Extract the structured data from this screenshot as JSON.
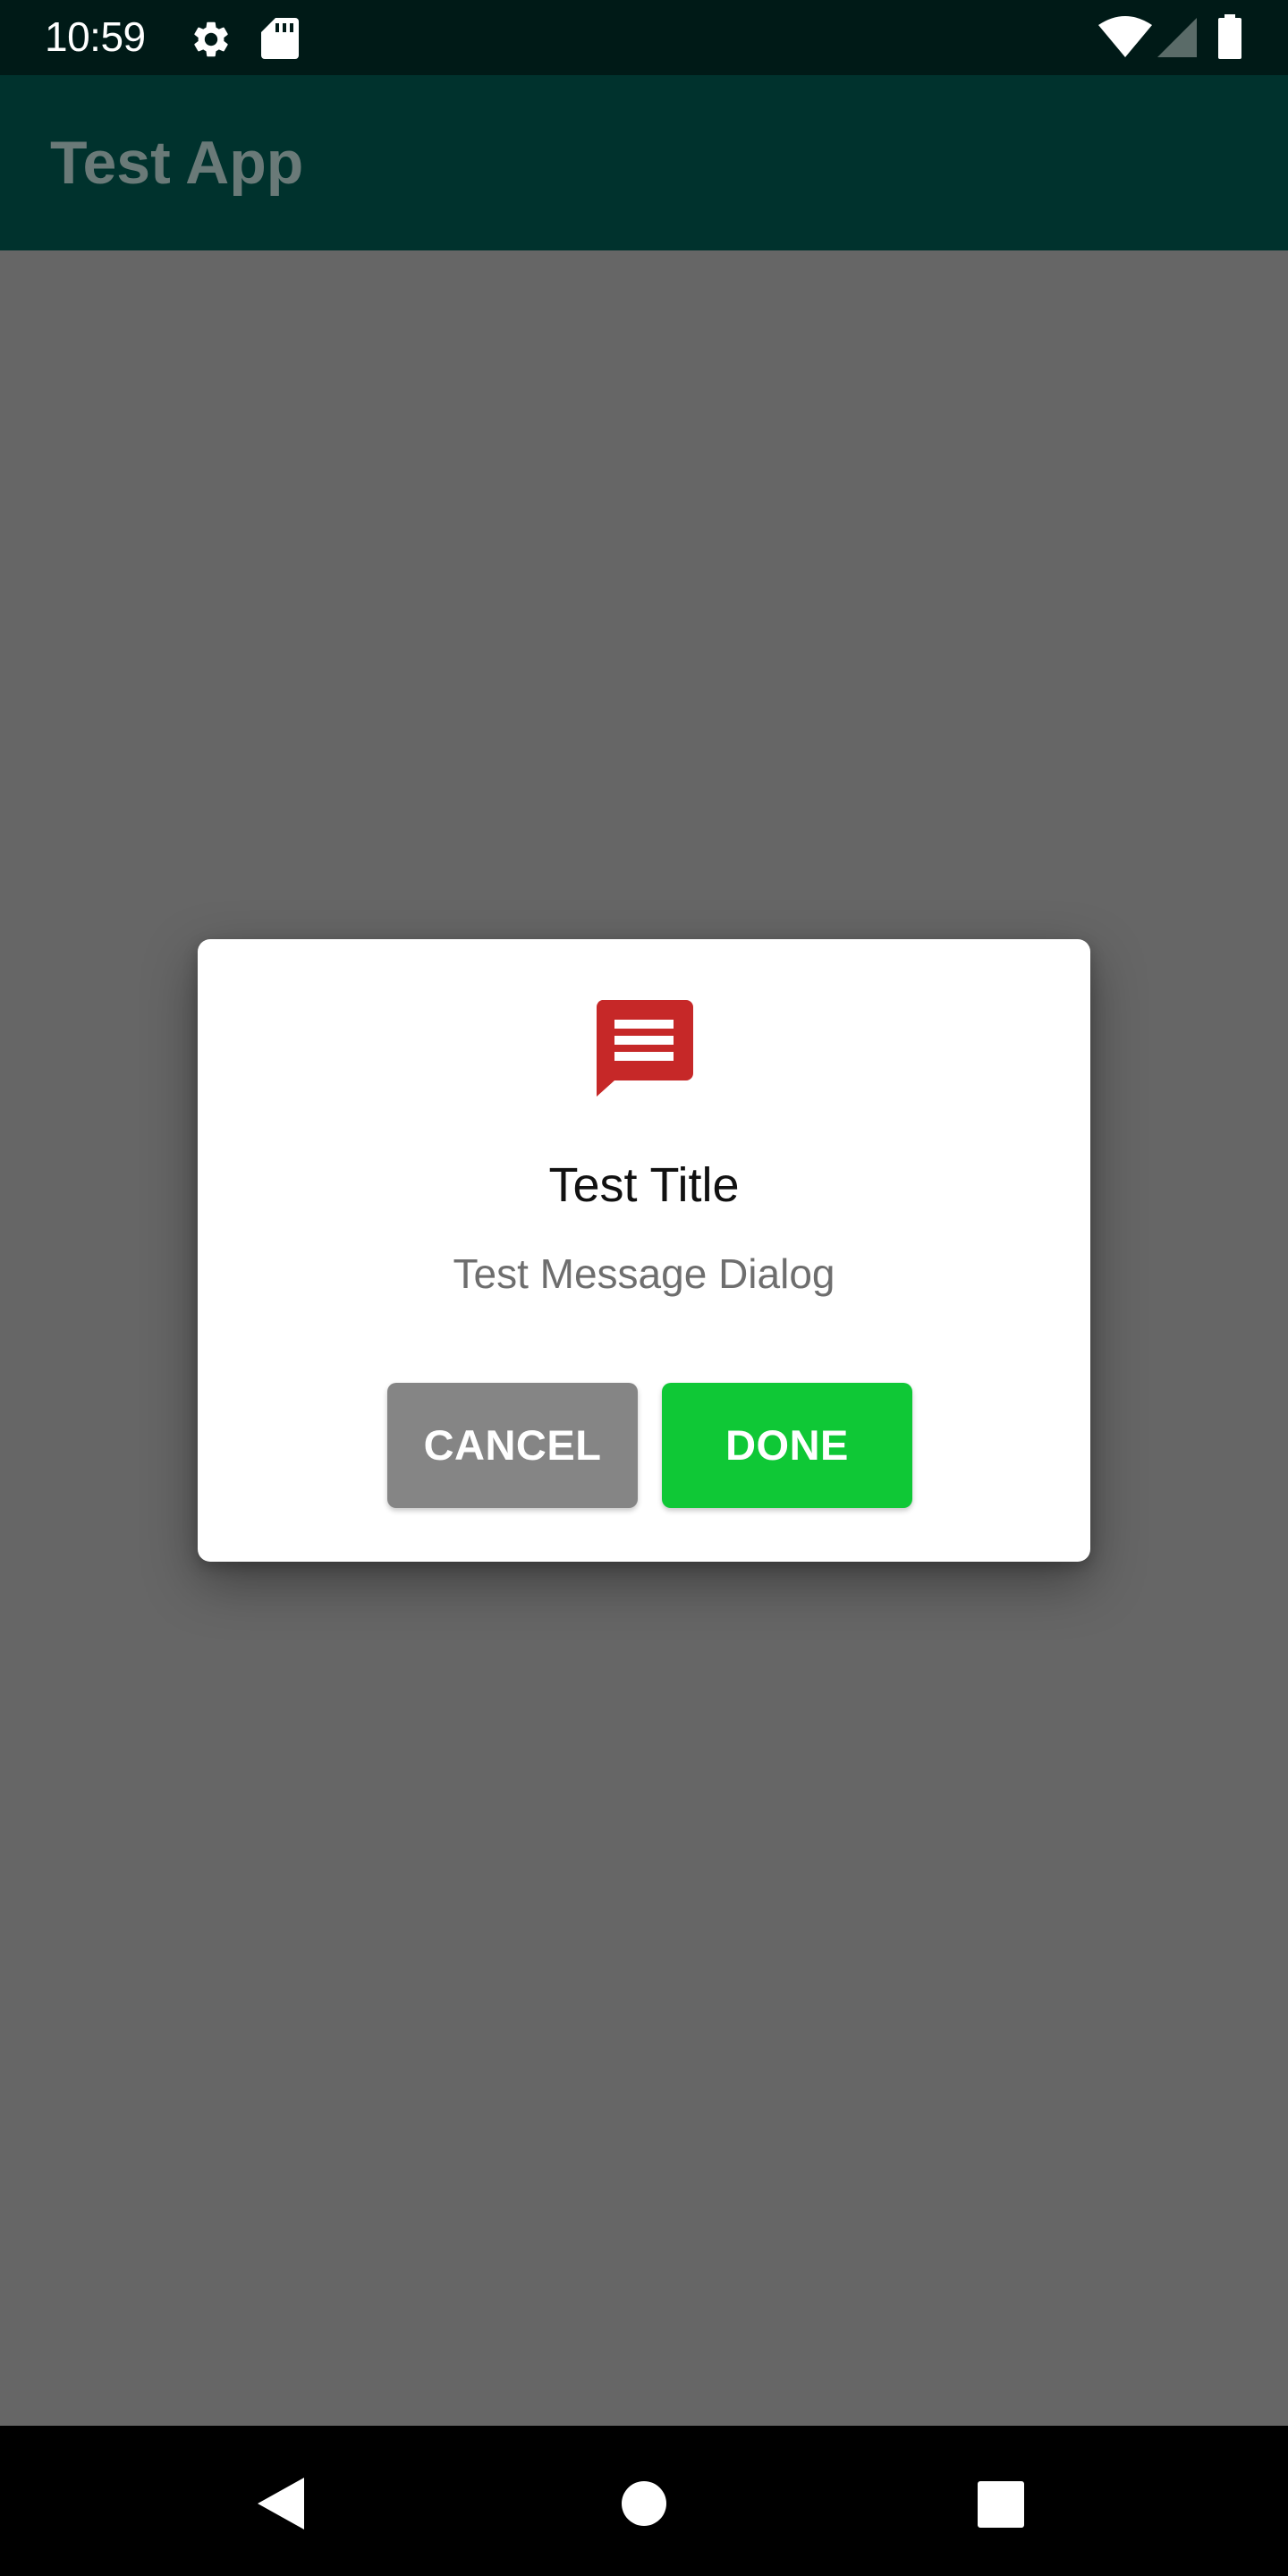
{
  "status_bar": {
    "time": "10:59",
    "left_icons": [
      "gear-icon",
      "sd-card-icon"
    ],
    "right_icons": [
      "wifi-icon",
      "cellular-signal-icon",
      "battery-icon"
    ]
  },
  "app_bar": {
    "title": "Test App"
  },
  "dialog": {
    "icon": "message-icon",
    "icon_color": "#c62828",
    "title": "Test Title",
    "message": "Test Message Dialog",
    "cancel_label": "CANCEL",
    "done_label": "DONE",
    "cancel_color": "#858585",
    "done_color": "#0fc836"
  },
  "nav_bar": {
    "buttons": [
      "back-icon",
      "home-icon",
      "recents-icon"
    ]
  },
  "colors": {
    "status_bar": "#001a17",
    "app_bar": "#00322d",
    "scrim_background": "#666666",
    "nav_bar": "#000000"
  }
}
